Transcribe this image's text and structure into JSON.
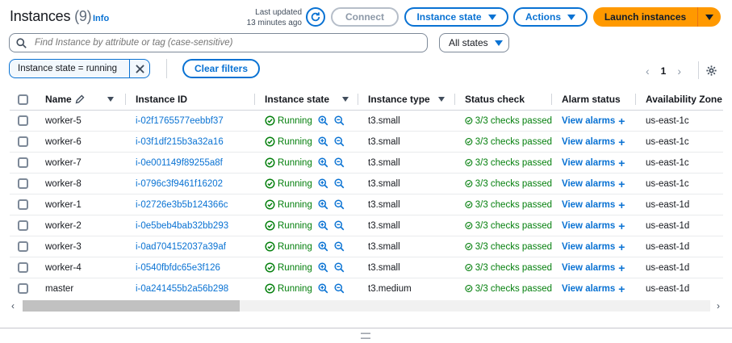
{
  "header": {
    "title": "Instances",
    "count": "(9)",
    "info": "Info",
    "last_updated_line1": "Last updated",
    "last_updated_line2": "13 minutes ago",
    "connect": "Connect",
    "instance_state": "Instance state",
    "actions": "Actions",
    "launch": "Launch instances"
  },
  "search": {
    "placeholder": "Find Instance by attribute or tag (case-sensitive)",
    "state_filter": "All states"
  },
  "filters": {
    "token": "Instance state = running",
    "clear": "Clear filters"
  },
  "pagination": {
    "page": "1"
  },
  "table": {
    "columns": [
      "Name",
      "Instance ID",
      "Instance state",
      "Instance type",
      "Status check",
      "Alarm status",
      "Availability Zone"
    ],
    "rows": [
      {
        "name": "worker-5",
        "id": "i-02f1765577eebbf37",
        "state": "Running",
        "type": "t3.small",
        "status": "3/3 checks passed",
        "alarm": "View alarms",
        "az": "us-east-1c"
      },
      {
        "name": "worker-6",
        "id": "i-03f1df215b3a32a16",
        "state": "Running",
        "type": "t3.small",
        "status": "3/3 checks passed",
        "alarm": "View alarms",
        "az": "us-east-1c"
      },
      {
        "name": "worker-7",
        "id": "i-0e001149f89255a8f",
        "state": "Running",
        "type": "t3.small",
        "status": "3/3 checks passed",
        "alarm": "View alarms",
        "az": "us-east-1c"
      },
      {
        "name": "worker-8",
        "id": "i-0796c3f9461f16202",
        "state": "Running",
        "type": "t3.small",
        "status": "3/3 checks passed",
        "alarm": "View alarms",
        "az": "us-east-1c"
      },
      {
        "name": "worker-1",
        "id": "i-02726e3b5b124366c",
        "state": "Running",
        "type": "t3.small",
        "status": "3/3 checks passed",
        "alarm": "View alarms",
        "az": "us-east-1d"
      },
      {
        "name": "worker-2",
        "id": "i-0e5beb4bab32bb293",
        "state": "Running",
        "type": "t3.small",
        "status": "3/3 checks passed",
        "alarm": "View alarms",
        "az": "us-east-1d"
      },
      {
        "name": "worker-3",
        "id": "i-0ad704152037a39af",
        "state": "Running",
        "type": "t3.small",
        "status": "3/3 checks passed",
        "alarm": "View alarms",
        "az": "us-east-1d"
      },
      {
        "name": "worker-4",
        "id": "i-0540fbfdc65e3f126",
        "state": "Running",
        "type": "t3.small",
        "status": "3/3 checks passed",
        "alarm": "View alarms",
        "az": "us-east-1d"
      },
      {
        "name": "master",
        "id": "i-0a241455b2a56b298",
        "state": "Running",
        "type": "t3.medium",
        "status": "3/3 checks passed",
        "alarm": "View alarms",
        "az": "us-east-1d"
      }
    ]
  },
  "scrollbar": {
    "position": 0
  },
  "colors": {
    "link": "#0972d3",
    "success": "#037f0c",
    "primary": "#ff9900"
  },
  "icons": [
    "refresh-icon",
    "caret-down-icon",
    "search-icon",
    "close-icon",
    "chevron-left-icon",
    "chevron-right-icon",
    "settings-icon",
    "edit-icon",
    "sort-icon",
    "success-icon",
    "zoom-in-icon",
    "zoom-out-icon",
    "plus-icon"
  ]
}
